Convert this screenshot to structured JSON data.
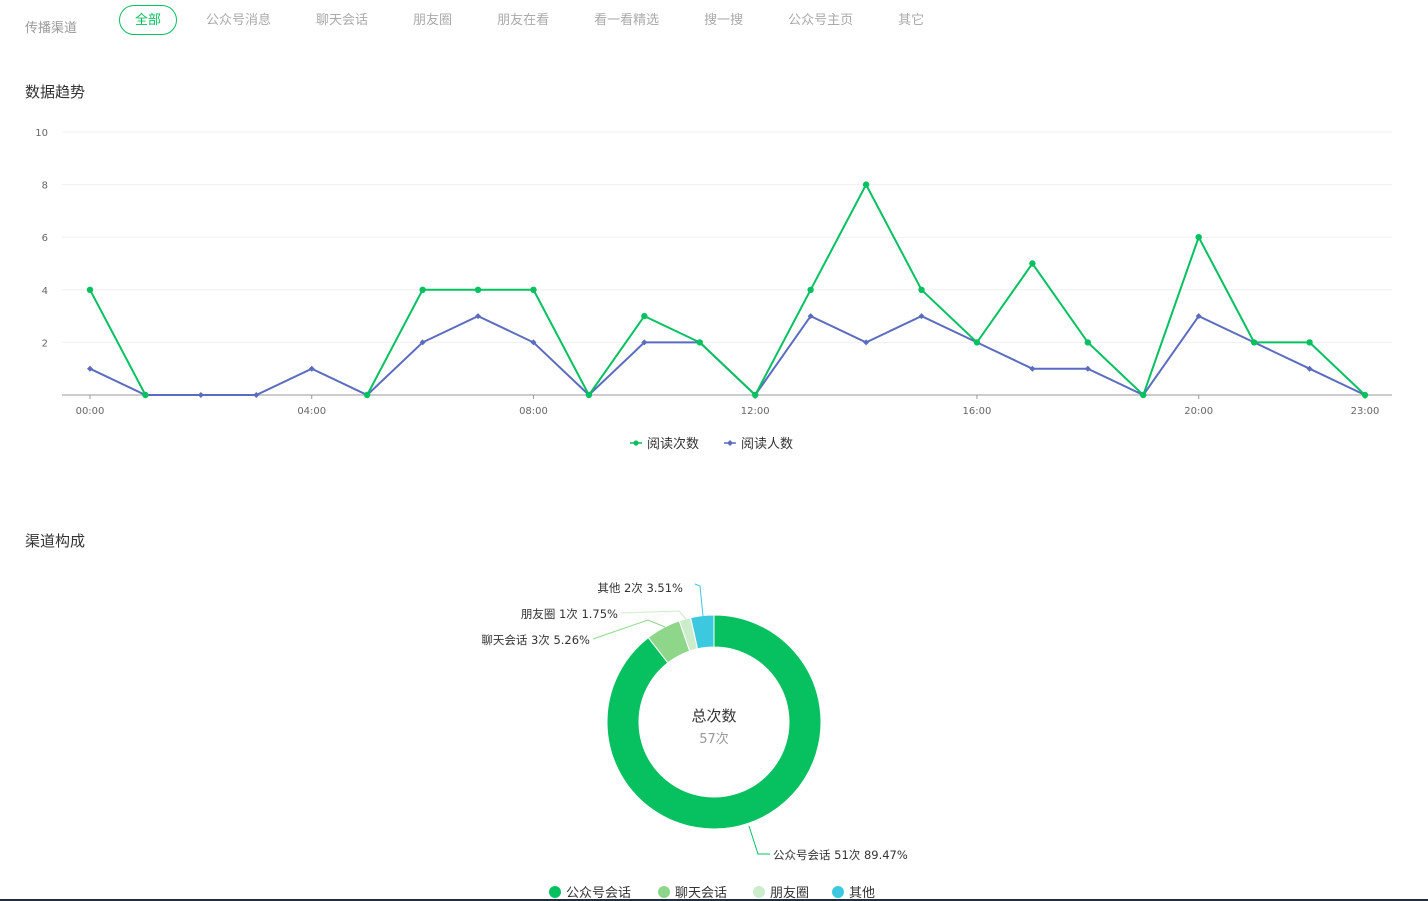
{
  "channel_filter": {
    "label": "传播渠道",
    "tabs": [
      {
        "label": "全部",
        "active": true
      },
      {
        "label": "公众号消息",
        "active": false
      },
      {
        "label": "聊天会话",
        "active": false
      },
      {
        "label": "朋友圈",
        "active": false
      },
      {
        "label": "朋友在看",
        "active": false
      },
      {
        "label": "看一看精选",
        "active": false
      },
      {
        "label": "搜一搜",
        "active": false
      },
      {
        "label": "公众号主页",
        "active": false
      },
      {
        "label": "其它",
        "active": false
      }
    ]
  },
  "sections": {
    "trend_title": "数据趋势",
    "channel_title": "渠道构成"
  },
  "colors": {
    "accent": "#07c160",
    "read_count": "#07c160",
    "reader_count": "#5b6cc0",
    "pie": [
      "#07c160",
      "#8dd68a",
      "#cdeccb",
      "#3cc8df"
    ]
  },
  "chart_data": [
    {
      "type": "line",
      "x_ticks": [
        "00:00",
        "04:00",
        "08:00",
        "12:00",
        "16:00",
        "20:00",
        "23:00"
      ],
      "x": [
        0,
        1,
        2,
        3,
        4,
        5,
        6,
        7,
        8,
        9,
        10,
        11,
        12,
        13,
        14,
        15,
        16,
        17,
        18,
        19,
        20,
        21,
        22,
        23
      ],
      "y_ticks": [
        "2",
        "4",
        "6",
        "8",
        "10"
      ],
      "ylim": [
        0,
        10
      ],
      "grid": true,
      "legend": "bottom-center",
      "series": [
        {
          "name": "阅读次数",
          "values": [
            4,
            0,
            null,
            null,
            null,
            0,
            4,
            4,
            4,
            0,
            3,
            2,
            0,
            4,
            8,
            4,
            2,
            5,
            2,
            0,
            6,
            2,
            2,
            0
          ]
        },
        {
          "name": "阅读人数",
          "values": [
            1,
            0,
            0,
            0,
            1,
            0,
            2,
            3,
            2,
            0,
            2,
            2,
            0,
            3,
            2,
            3,
            2,
            1,
            1,
            0,
            3,
            2,
            1,
            0
          ]
        }
      ]
    },
    {
      "type": "pie",
      "donut": true,
      "center_title": "总次数",
      "center_value": "57次",
      "slices": [
        {
          "name": "公众号会话",
          "label": "公众号会话 51次 89.47%",
          "value": 51
        },
        {
          "name": "聊天会话",
          "label": "聊天会话 3次 5.26%",
          "value": 3
        },
        {
          "name": "朋友圈",
          "label": "朋友圈 1次 1.75%",
          "value": 1
        },
        {
          "name": "其他",
          "label": "其他 2次 3.51%",
          "value": 2
        }
      ],
      "legend": "bottom-center"
    }
  ]
}
